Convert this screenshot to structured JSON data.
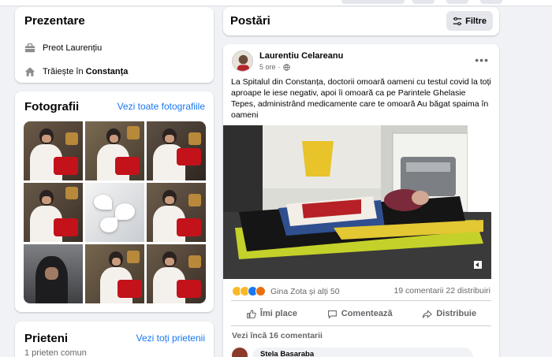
{
  "intro": {
    "title": "Prezentare",
    "rows": [
      {
        "icon": "briefcase-icon",
        "text": "Preot Laurențiu"
      },
      {
        "icon": "home-icon",
        "prefix": "Trăiește în ",
        "bold": "Constanța"
      }
    ]
  },
  "photos": {
    "title": "Fotografii",
    "see_all": "Vezi toate fotografiile"
  },
  "friends": {
    "title": "Prieteni",
    "see_all": "Vezi toți prietenii",
    "mutual": "1 prieten comun"
  },
  "posts_header": {
    "title": "Postări",
    "filter_label": "Filtre"
  },
  "post": {
    "author": "Laurentiu Celareanu",
    "time": "5 ore",
    "text": "La Spitalul din Constanța, doctorii omoară oameni cu testul covid la toți aproape  le iese negativ, apoi îi omoară ca pe Parintele Ghelasie Tepes, administrând medicamente care te omoară Au băgat spaima în oameni",
    "reactions_label": "Gina Zota și alți 50",
    "comments_count": "19 comentarii",
    "shares_count": "22 distribuiri",
    "actions": {
      "like": "Îmi place",
      "comment": "Comentează",
      "share": "Distribuie"
    },
    "view_more_comments": "Vezi încă 16 comentarii",
    "preview_commenter": "Stela Basaraba"
  },
  "colors": {
    "accent": "#1877f2",
    "page_bg": "#f0f2f5",
    "muted": "#65676b"
  }
}
